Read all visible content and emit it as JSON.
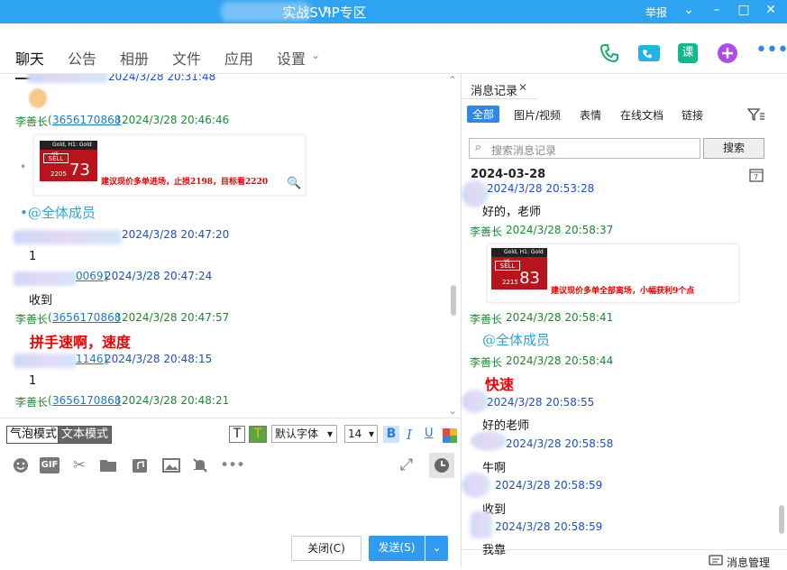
{
  "window": {
    "title_visible": "实战SVIP专区",
    "report": "举报",
    "controls": [
      "chevron-down",
      "minimize",
      "maximize",
      "close"
    ]
  },
  "nav": {
    "tabs": [
      "聊天",
      "公告",
      "相册",
      "文件",
      "应用",
      "设置"
    ],
    "top_icons": [
      "phone-icon",
      "video-icon",
      "lesson-icon",
      "add-icon",
      "more-icon"
    ],
    "lesson_label": "课"
  },
  "chat": {
    "messages": [
      {
        "sender_id": "",
        "time": "2024/3/28 20:31:48",
        "color": "blue"
      },
      {
        "sender": "李善长",
        "qq": "3656170868",
        "time": "2024/3/28 20:46:46",
        "color": "green"
      },
      {
        "image_caption": "建议现价多单进场，止损2198，目标看2220",
        "sell_label": "SELL",
        "price_small": "2205",
        "price_big": "73"
      },
      {
        "text": "•@全体成员"
      },
      {
        "time": "2024/3/28 20:47:20",
        "color": "blue",
        "body": "1"
      },
      {
        "qq_tail": "0069)",
        "time": "2024/3/28 20:47:24",
        "color": "blue",
        "body": "收到"
      },
      {
        "sender": "李善长",
        "qq": "3656170868",
        "time": "2024/3/28 20:47:57",
        "color": "green",
        "body": "拼手速啊，速度"
      },
      {
        "qq_tail": "1146)",
        "time": "2024/3/28 20:48:15",
        "color": "blue",
        "body": "1"
      },
      {
        "sender": "李善长",
        "qq": "3656170868",
        "time": "2024/3/28 20:48:21",
        "color": "green"
      }
    ]
  },
  "composer": {
    "bubble_mode": "气泡模式",
    "text_mode": "文本模式",
    "font": "默认字体",
    "font_size": "14",
    "bold": "B",
    "italic": "I",
    "underline": "U",
    "gif": "GIF",
    "close_label": "关闭(C)",
    "send_label": "发送(S)"
  },
  "history": {
    "tab": "消息记录",
    "filters": [
      "全部",
      "图片/视频",
      "表情",
      "在线文档",
      "链接"
    ],
    "search_placeholder": "搜索消息记录",
    "search_btn": "搜索",
    "date": "2024-03-28",
    "messages": [
      {
        "time": "2024/3/28 20:53:28",
        "body": "好的，老师"
      },
      {
        "sender": "李善长",
        "time": "2024/3/28 20:58:37",
        "image_caption": "建议现价多单全部离场，小幅获利9个点",
        "sell_label": "SELL",
        "price_small": "2215",
        "price_big": "83"
      },
      {
        "sender": "李善长",
        "time": "2024/3/28 20:58:41",
        "body": "@全体成员"
      },
      {
        "sender": "李善长",
        "time": "2024/3/28 20:58:44",
        "body": "快速"
      },
      {
        "time": "2024/3/28 20:58:55",
        "body": "好的老师"
      },
      {
        "time": "2024/3/28 20:58:58",
        "body": "牛啊"
      },
      {
        "time": "2024/3/28 20:58:59",
        "body": "收到"
      },
      {
        "time": "2024/3/28 20:58:59",
        "body": "我靠"
      }
    ],
    "manage": "消息管理"
  },
  "colors": {
    "titlebar": "#2ea3f2",
    "green_sender": "#1b8a34",
    "blue_sender": "#1a4fd6",
    "send_button": "#2f9cf2",
    "alert_red": "#e00000"
  }
}
